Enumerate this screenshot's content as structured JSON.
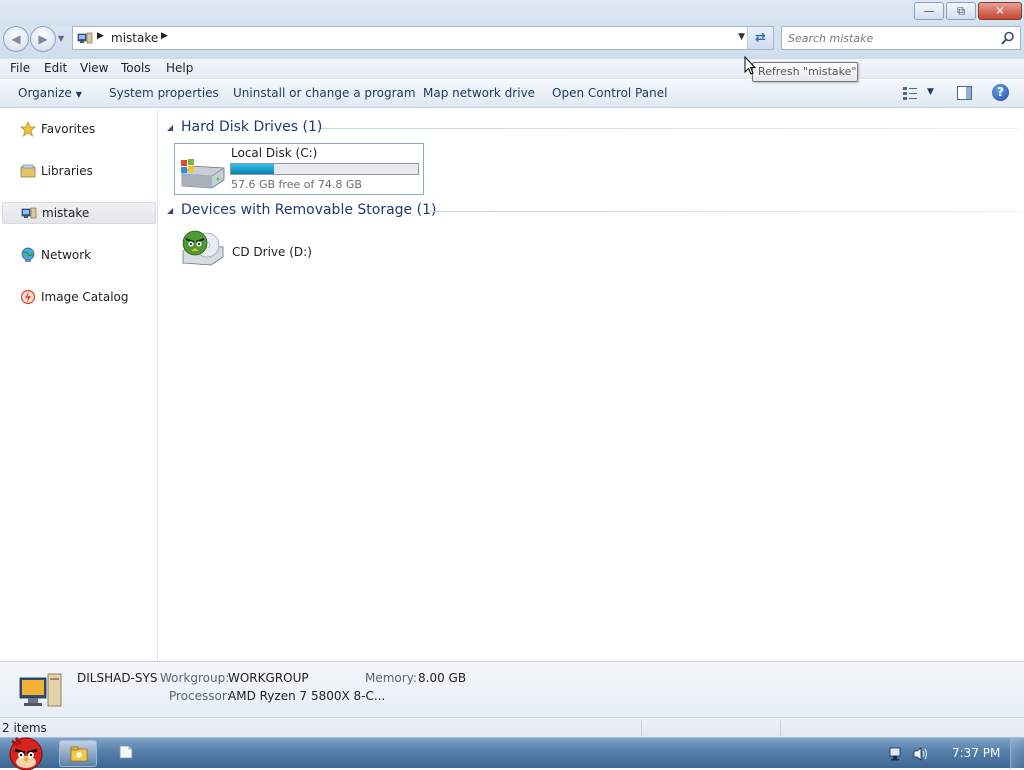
{
  "window": {
    "buttons": {
      "minimize_glyph": "—",
      "maximize_glyph": "⧉",
      "close_glyph": "✕"
    }
  },
  "navigation": {
    "back_glyph": "◀",
    "forward_glyph": "▶",
    "address_crumb": "mistake",
    "search_placeholder": "Search mistake",
    "tooltip": "Refresh \"mistake\""
  },
  "menu": {
    "items": [
      "File",
      "Edit",
      "View",
      "Tools",
      "Help"
    ]
  },
  "commandbar": {
    "organize": "Organize",
    "system_properties": "System properties",
    "uninstall": "Uninstall or change a program",
    "map_drive": "Map network drive",
    "control_panel": "Open Control Panel",
    "help_glyph": "?"
  },
  "sidebar": {
    "items": [
      {
        "label": "Favorites",
        "icon": "star-icon"
      },
      {
        "label": "Libraries",
        "icon": "libraries-icon"
      },
      {
        "label": "mistake",
        "icon": "computer-icon",
        "selected": true
      },
      {
        "label": "Network",
        "icon": "network-icon"
      },
      {
        "label": "Image Catalog",
        "icon": "image-catalog-icon"
      }
    ]
  },
  "content": {
    "groups": [
      {
        "title": "Hard Disk Drives (1)"
      },
      {
        "title": "Devices with Removable Storage (1)"
      }
    ],
    "local_disk": {
      "name": "Local Disk (C:)",
      "free_text": "57.6 GB free of 74.8 GB",
      "used_fraction": 0.23
    },
    "cd_drive": {
      "name": "CD Drive (D:)"
    }
  },
  "details": {
    "computer_name": "DILSHAD-SYS",
    "workgroup_label": "Workgroup:",
    "workgroup_value": "WORKGROUP",
    "memory_label": "Memory:",
    "memory_value": "8.00 GB",
    "processor_label": "Processor:",
    "processor_value": "AMD Ryzen 7 5800X 8-C..."
  },
  "status": {
    "items_text": "2 items"
  },
  "taskbar": {
    "clock": "7:37 PM"
  },
  "colors": {
    "accent": "#1e3a70",
    "disk_fill": "#1a9cc9",
    "taskbar": "#557ea9"
  }
}
